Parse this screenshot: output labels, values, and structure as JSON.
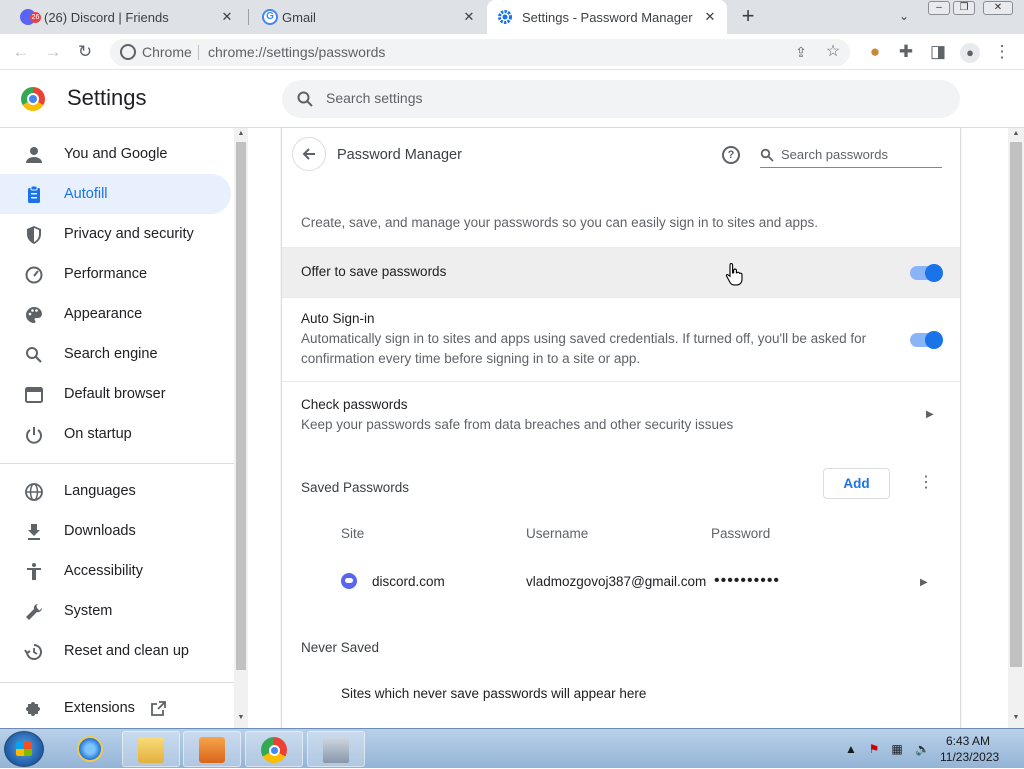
{
  "browser": {
    "tabs": [
      {
        "title": "(26) Discord | Friends",
        "badge": "26",
        "active": false
      },
      {
        "title": "Gmail",
        "active": false
      },
      {
        "title": "Settings - Password Manager",
        "active": true
      }
    ],
    "new_tab": "+",
    "omnibox": {
      "site_label": "Chrome",
      "url": "chrome://settings/passwords"
    }
  },
  "settings": {
    "title": "Settings",
    "search_placeholder": "Search settings",
    "sidebar": {
      "items": [
        {
          "label": "You and Google",
          "icon": "person-icon"
        },
        {
          "label": "Autofill",
          "icon": "clipboard-icon",
          "active": true
        },
        {
          "label": "Privacy and security",
          "icon": "shield-icon"
        },
        {
          "label": "Performance",
          "icon": "speedometer-icon"
        },
        {
          "label": "Appearance",
          "icon": "palette-icon"
        },
        {
          "label": "Search engine",
          "icon": "search-icon"
        },
        {
          "label": "Default browser",
          "icon": "browser-window-icon"
        },
        {
          "label": "On startup",
          "icon": "power-icon"
        },
        {
          "label": "Languages",
          "icon": "globe-icon"
        },
        {
          "label": "Downloads",
          "icon": "download-icon"
        },
        {
          "label": "Accessibility",
          "icon": "accessibility-icon"
        },
        {
          "label": "System",
          "icon": "wrench-icon"
        },
        {
          "label": "Reset and clean up",
          "icon": "history-icon"
        },
        {
          "label": "Extensions",
          "icon": "puzzle-icon"
        }
      ]
    },
    "password_manager": {
      "title": "Password Manager",
      "search_placeholder": "Search passwords",
      "description": "Create, save, and manage your passwords so you can easily sign in to sites and apps.",
      "offer_to_save": {
        "label": "Offer to save passwords",
        "enabled": true
      },
      "auto_signin": {
        "label": "Auto Sign-in",
        "sublabel": "Automatically sign in to sites and apps using saved credentials. If turned off, you'll be asked for confirmation every time before signing in to a site or app.",
        "enabled": true
      },
      "check_passwords": {
        "label": "Check passwords",
        "sublabel": "Keep your passwords safe from data breaches and other security issues"
      },
      "saved_passwords": {
        "heading": "Saved Passwords",
        "add_label": "Add",
        "columns": [
          "Site",
          "Username",
          "Password"
        ],
        "rows": [
          {
            "site": "discord.com",
            "username": "vladmozgovoj387@gmail.com",
            "password": "••••••••••"
          }
        ]
      },
      "never_saved": {
        "heading": "Never Saved",
        "empty_message": "Sites which never save passwords will appear here"
      }
    }
  },
  "taskbar": {
    "clock_time": "6:43 AM",
    "clock_date": "11/23/2023"
  },
  "colors": {
    "accent": "#1a73e8",
    "active_nav_bg": "#e8f0fe",
    "toggle_track": "#8ab4f8"
  }
}
